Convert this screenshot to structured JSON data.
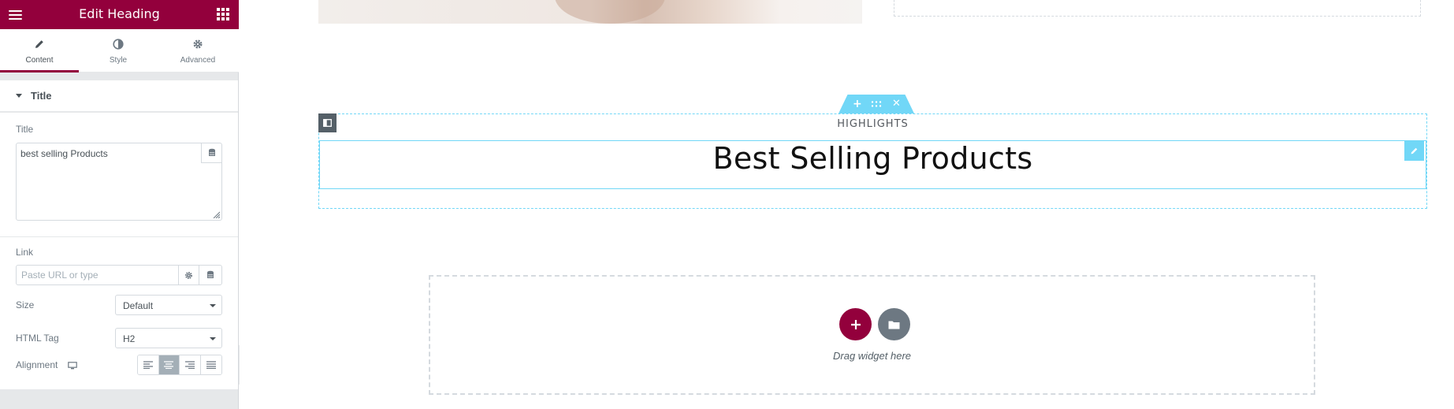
{
  "panel": {
    "header_title": "Edit Heading",
    "tabs": [
      {
        "label": "Content",
        "icon": "pencil-icon",
        "active": true
      },
      {
        "label": "Style",
        "icon": "half-circle-icon",
        "active": false
      },
      {
        "label": "Advanced",
        "icon": "gear-icon",
        "active": false
      }
    ],
    "section_title": "Title",
    "controls": {
      "title_label": "Title",
      "title_value": "best selling Products",
      "link_label": "Link",
      "link_placeholder": "Paste URL or type",
      "size_label": "Size",
      "size_value": "Default",
      "html_tag_label": "HTML Tag",
      "html_tag_value": "H2",
      "alignment_label": "Alignment",
      "alignment_active": "center"
    }
  },
  "canvas": {
    "highlights_text": "HIGHLIGHTS",
    "heading_text": "Best Selling Products",
    "drag_text": "Drag widget here"
  },
  "colors": {
    "brand": "#93003c",
    "accent": "#71d7f7"
  }
}
